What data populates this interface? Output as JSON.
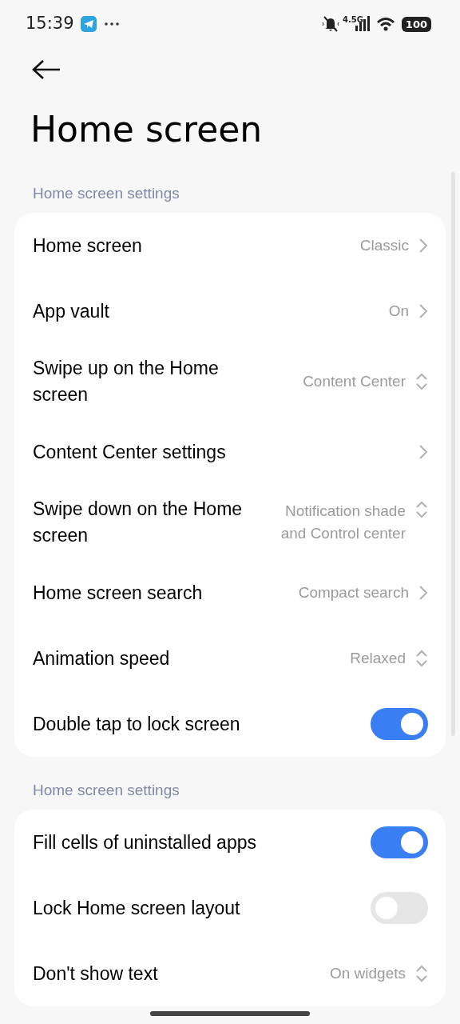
{
  "status_bar": {
    "time": "15:39",
    "network": "4.5G",
    "battery": "100"
  },
  "title": "Home screen",
  "sections": [
    {
      "label": "Home screen settings",
      "rows": [
        {
          "kind": "link",
          "label": "Home screen",
          "value": "Classic"
        },
        {
          "kind": "link",
          "label": "App vault",
          "value": "On"
        },
        {
          "kind": "select",
          "label": "Swipe up on the Home screen",
          "value": "Content Center"
        },
        {
          "kind": "link",
          "label": "Content Center settings"
        },
        {
          "kind": "select",
          "label": "Swipe down on the Home screen",
          "value": "Notification shade and Control center"
        },
        {
          "kind": "link",
          "label": "Home screen search",
          "value": "Compact search"
        },
        {
          "kind": "select",
          "label": "Animation speed",
          "value": "Relaxed"
        },
        {
          "kind": "toggle",
          "label": "Double tap to lock screen",
          "on": true
        }
      ]
    },
    {
      "label": "Home screen settings",
      "rows": [
        {
          "kind": "toggle",
          "label": "Fill cells of uninstalled apps",
          "on": true
        },
        {
          "kind": "toggle",
          "label": "Lock Home screen layout",
          "on": false
        },
        {
          "kind": "select",
          "label": "Don't show text",
          "value": "On widgets"
        }
      ]
    }
  ]
}
